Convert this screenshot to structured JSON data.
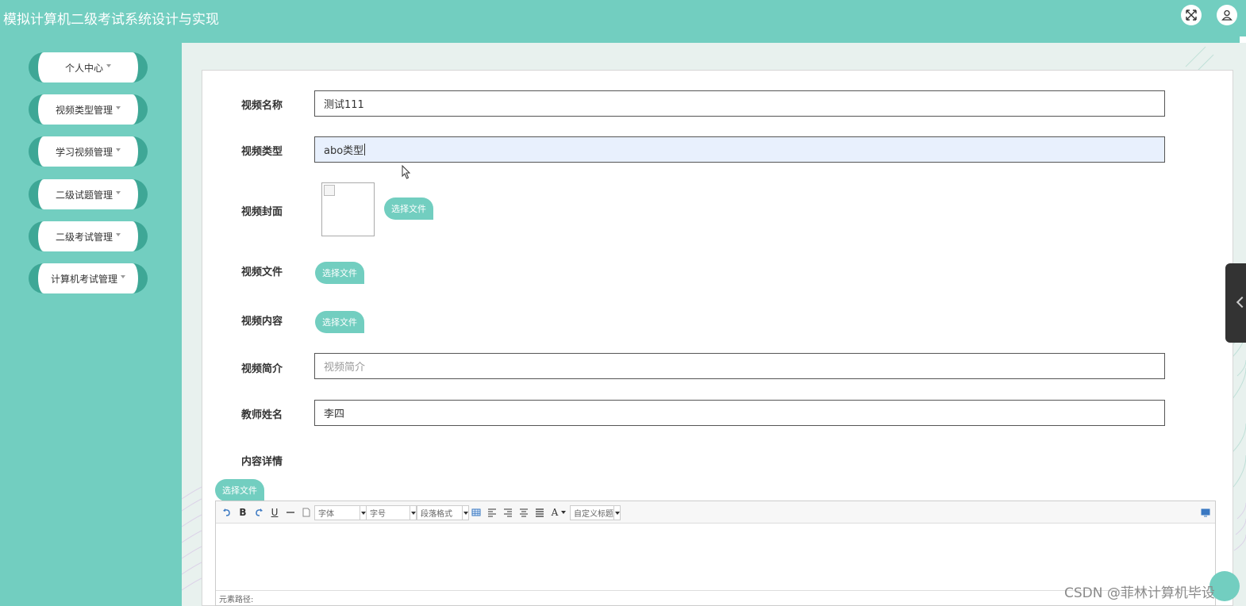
{
  "header": {
    "app_title": "模拟计算机二级考试系统设计与实现",
    "fullscreen_icon": "fullscreen-icon",
    "user_icon": "user-icon"
  },
  "sidebar": {
    "items": [
      {
        "label": "个人中心"
      },
      {
        "label": "视频类型管理"
      },
      {
        "label": "学习视频管理"
      },
      {
        "label": "二级试题管理"
      },
      {
        "label": "二级考试管理"
      },
      {
        "label": "计算机考试管理"
      }
    ]
  },
  "form": {
    "video_name": {
      "label": "视频名称",
      "value": "测试111"
    },
    "video_type": {
      "label": "视频类型",
      "value": "abo类型"
    },
    "video_cover": {
      "label": "视频封面",
      "button": "选择文件"
    },
    "video_file": {
      "label": "视频文件",
      "button": "选择文件"
    },
    "video_content": {
      "label": "视频内容",
      "button": "选择文件"
    },
    "video_intro": {
      "label": "视频简介",
      "placeholder": "视频简介",
      "value": ""
    },
    "teacher_name": {
      "label": "教师姓名",
      "value": "李四"
    },
    "content_detail": {
      "label": "内容详情",
      "button": "选择文件"
    }
  },
  "editor": {
    "bold": "B",
    "underline": "U",
    "font_select": "字体",
    "size_select": "字号",
    "paragraph_select": "段落格式",
    "font_color": "A",
    "custom_title_select": "自定义标题",
    "element_path": "元素路径:"
  },
  "watermark": "CSDN @菲林计算机毕设",
  "colors": {
    "theme": "#72cec0",
    "theme_dark": "#3ea796"
  }
}
